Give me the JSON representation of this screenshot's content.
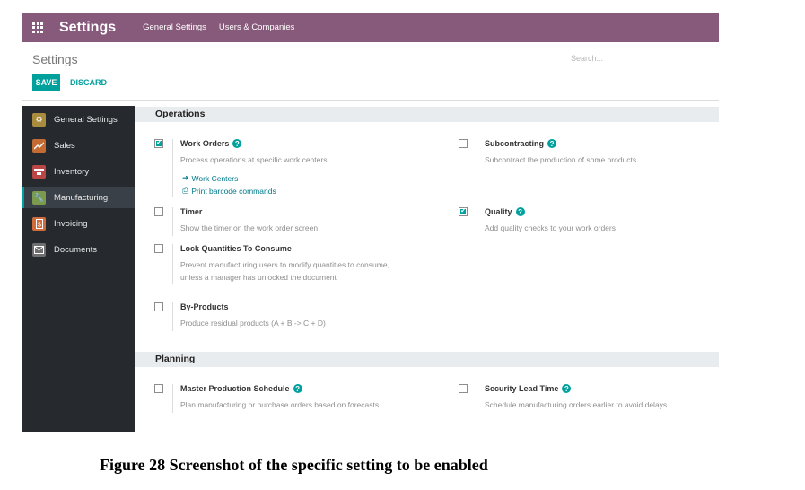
{
  "navbar": {
    "title": "Settings",
    "menu": [
      "General Settings",
      "Users & Companies"
    ]
  },
  "control_panel": {
    "title": "Settings",
    "search_placeholder": "Search...",
    "save_label": "SAVE",
    "discard_label": "DISCARD"
  },
  "sidebar": {
    "items": [
      {
        "label": "General Settings",
        "icon": "gear-icon",
        "color": "#a98c3d"
      },
      {
        "label": "Sales",
        "icon": "chart-icon",
        "color": "#c46b33"
      },
      {
        "label": "Inventory",
        "icon": "boxes-icon",
        "color": "#b94745"
      },
      {
        "label": "Manufacturing",
        "icon": "wrench-icon",
        "color": "#7c9a4e"
      },
      {
        "label": "Invoicing",
        "icon": "invoice-icon",
        "color": "#d06b3b"
      },
      {
        "label": "Documents",
        "icon": "documents-icon",
        "color": "#6f6f6f"
      }
    ],
    "active": "Manufacturing"
  },
  "sections": {
    "operations": {
      "title": "Operations",
      "settings": {
        "work_orders": {
          "title": "Work Orders",
          "desc": "Process operations at specific work centers",
          "checked": true,
          "links": [
            "Work Centers",
            "Print barcode commands"
          ]
        },
        "subcontracting": {
          "title": "Subcontracting",
          "desc": "Subcontract the production of some products",
          "checked": false
        },
        "timer": {
          "title": "Timer",
          "desc": "Show the timer on the work order screen",
          "checked": false
        },
        "quality": {
          "title": "Quality",
          "desc": "Add quality checks to your work orders",
          "checked": true
        },
        "lock_quantities": {
          "title": "Lock Quantities To Consume",
          "desc_line1": "Prevent manufacturing users to modify quantities to consume,",
          "desc_line2": "unless a manager has unlocked the document",
          "checked": false
        },
        "by_products": {
          "title": "By-Products",
          "desc": "Produce residual products (A + B -> C + D)",
          "checked": false
        }
      }
    },
    "planning": {
      "title": "Planning",
      "settings": {
        "mps": {
          "title": "Master Production Schedule",
          "desc": "Plan manufacturing or purchase orders based on forecasts",
          "checked": false
        },
        "security_lead_time": {
          "title": "Security Lead Time",
          "desc": "Schedule manufacturing orders earlier to avoid delays",
          "checked": false
        }
      }
    }
  },
  "caption": "Figure 28 Screenshot of the specific setting to be enabled",
  "colors": {
    "brand": "#875a7b",
    "accent": "#00a09d",
    "sidebar": "#262a2f"
  }
}
